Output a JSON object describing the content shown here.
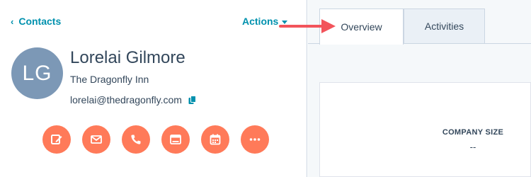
{
  "contact": {
    "back_label": "Contacts",
    "actions_label": "Actions",
    "avatar_initials": "LG",
    "name": "Lorelai Gilmore",
    "company": "The Dragonfly Inn",
    "email": "lorelai@thedragonfly.com"
  },
  "quick_actions": [
    {
      "icon": "note-icon"
    },
    {
      "icon": "email-icon"
    },
    {
      "icon": "call-icon"
    },
    {
      "icon": "log-activity-icon"
    },
    {
      "icon": "meeting-icon"
    },
    {
      "icon": "more-icon"
    }
  ],
  "tabs": [
    {
      "label": "Overview",
      "active": true
    },
    {
      "label": "Activities",
      "active": false
    }
  ],
  "overview_card": {
    "stat_label": "COMPANY SIZE",
    "stat_value": "--"
  },
  "colors": {
    "accent": "#0091ae",
    "action_button": "#ff7a59",
    "avatar": "#7c98b6",
    "annotation_arrow": "#f2545b"
  }
}
